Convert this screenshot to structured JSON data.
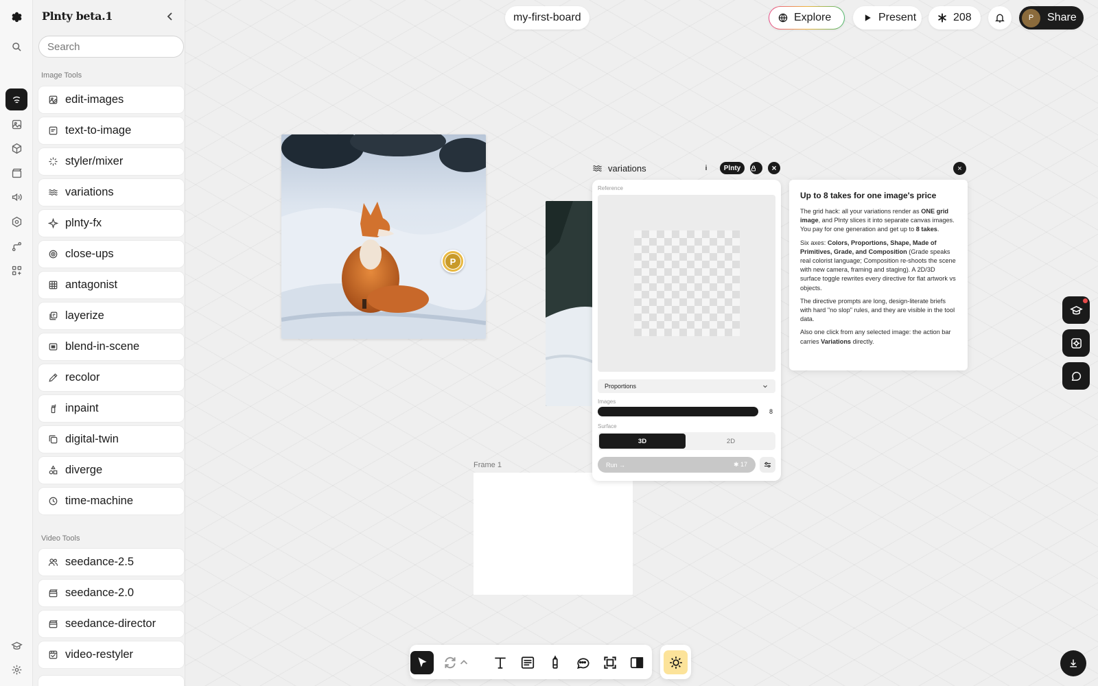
{
  "app": {
    "brand": "Plnty beta.1"
  },
  "search": {
    "placeholder": "Search"
  },
  "sections": {
    "image_tools": "Image Tools",
    "video_tools": "Video Tools"
  },
  "image_tools": [
    {
      "label": "edit-images",
      "icon": "image-edit-icon"
    },
    {
      "label": "text-to-image",
      "icon": "text-image-icon"
    },
    {
      "label": "styler/mixer",
      "icon": "sparkle-icon"
    },
    {
      "label": "variations",
      "icon": "waves-icon"
    },
    {
      "label": "plnty-fx",
      "icon": "sparkle-star-icon"
    },
    {
      "label": "close-ups",
      "icon": "target-icon"
    },
    {
      "label": "antagonist",
      "icon": "grid-icon"
    },
    {
      "label": "layerize",
      "icon": "layers-icon"
    },
    {
      "label": "blend-in-scene",
      "icon": "blend-icon"
    },
    {
      "label": "recolor",
      "icon": "dropper-icon"
    },
    {
      "label": "inpaint",
      "icon": "spray-icon"
    },
    {
      "label": "digital-twin",
      "icon": "copy-icon"
    },
    {
      "label": "diverge",
      "icon": "shapes-icon"
    },
    {
      "label": "time-machine",
      "icon": "clock-icon"
    }
  ],
  "video_tools": [
    {
      "label": "seedance-2.5",
      "icon": "users-icon"
    },
    {
      "label": "seedance-2.0",
      "icon": "clapper-icon"
    },
    {
      "label": "seedance-director",
      "icon": "clapper-icon"
    },
    {
      "label": "video-restyler",
      "icon": "restyle-icon"
    }
  ],
  "topbar": {
    "board_name": "my-first-board",
    "explore": "Explore",
    "present": "Present",
    "credits": "208",
    "avatar_initial": "P",
    "share": "Share"
  },
  "canvas": {
    "frame_label": "Frame 1",
    "marker_initial": "P"
  },
  "node": {
    "title": "variations",
    "badge_info": "i",
    "badge_model": "Plnty",
    "close": "×",
    "reference_label": "Reference",
    "axis_value": "Proportions",
    "images_label": "Images",
    "images_value": "8",
    "surface_label": "Surface",
    "surface_options": [
      "3D",
      "2D"
    ],
    "surface_selected": "3D",
    "run_label": "Run →",
    "run_cost": "✱ 17"
  },
  "info_card": {
    "title": "Up to 8 takes for one image's price",
    "p1_a": "The grid hack: all your variations render as ",
    "p1_b": "ONE grid image",
    "p1_c": ", and Plnty slices it into separate canvas images. You pay for one generation and get up to ",
    "p1_d": "8 takes",
    "p1_e": ".",
    "p2_a": "Six axes: ",
    "p2_b": "Colors, Proportions, Shape, Made of Primitives, Grade, and Composition",
    "p2_c": " (Grade speaks real colorist language; Composition re-shoots the scene with new camera, framing and staging). A 2D/3D surface toggle rewrites every directive for flat artwork vs objects.",
    "p3": "The directive prompts are long, design-literate briefs with hard \"no slop\" rules, and they are visible in the tool data.",
    "p4_a": "Also one click from any selected image: the action bar carries ",
    "p4_b": "Variations",
    "p4_c": " directly.",
    "close": "×"
  },
  "colors": {
    "accent_dark": "#1a1a1a",
    "marker_gold": "#e8b840",
    "sun_yellow": "#fce39a"
  }
}
